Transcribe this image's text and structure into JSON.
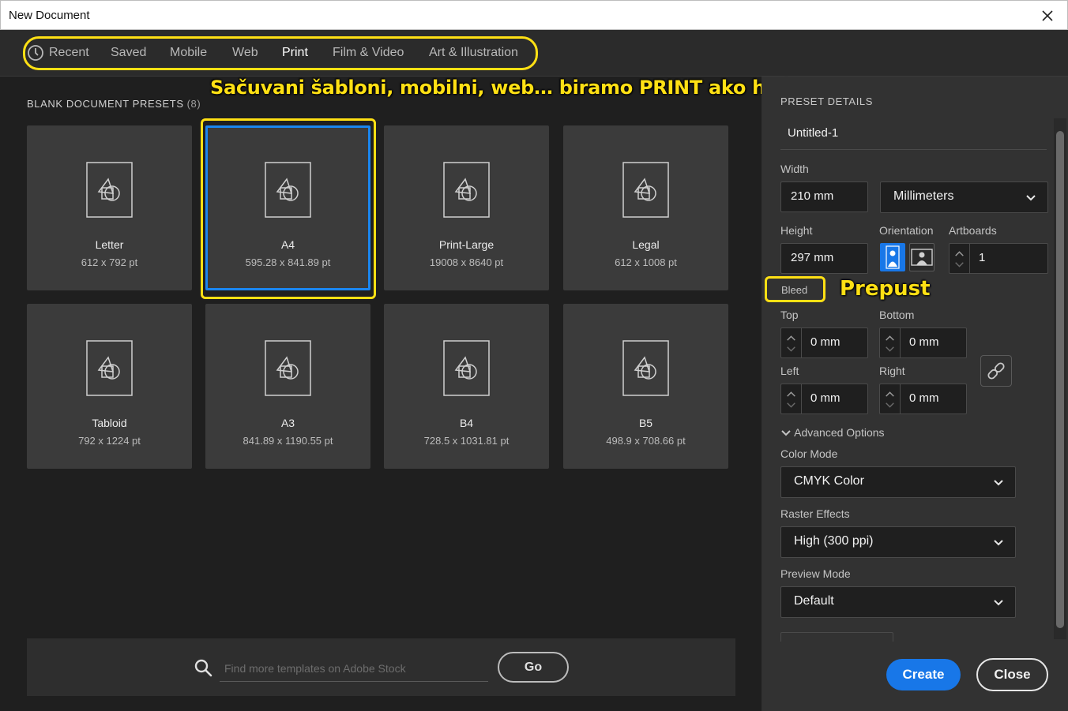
{
  "window": {
    "title": "New Document"
  },
  "tabs": [
    "Recent",
    "Saved",
    "Mobile",
    "Web",
    "Print",
    "Film & Video",
    "Art & Illustration"
  ],
  "active_tab": "Print",
  "annotations": {
    "tabs_note": "Sačuvani šabloni, mobilni, web… biramo PRINT ako hoćemo CMYK boje",
    "bleed_note": "Prepust"
  },
  "presets": {
    "title": "BLANK DOCUMENT PRESETS",
    "count": "(8)",
    "items": [
      {
        "name": "Letter",
        "dims": "612 x 792 pt"
      },
      {
        "name": "A4",
        "dims": "595.28 x 841.89 pt"
      },
      {
        "name": "Print-Large",
        "dims": "19008 x 8640 pt"
      },
      {
        "name": "Legal",
        "dims": "612 x 1008 pt"
      },
      {
        "name": "Tabloid",
        "dims": "792 x 1224 pt"
      },
      {
        "name": "A3",
        "dims": "841.89 x 1190.55 pt"
      },
      {
        "name": "B4",
        "dims": "728.5 x 1031.81 pt"
      },
      {
        "name": "B5",
        "dims": "498.9 x 708.66 pt"
      }
    ],
    "selected": "A4"
  },
  "search": {
    "placeholder": "Find more templates on Adobe Stock",
    "go_label": "Go"
  },
  "details": {
    "title": "PRESET DETAILS",
    "doc_name": "Untitled-1",
    "width_label": "Width",
    "width_value": "210 mm",
    "units": "Millimeters",
    "height_label": "Height",
    "height_value": "297 mm",
    "orientation_label": "Orientation",
    "artboards_label": "Artboards",
    "artboards_value": "1",
    "bleed_label": "Bleed",
    "top_label": "Top",
    "top_value": "0 mm",
    "bottom_label": "Bottom",
    "bottom_value": "0 mm",
    "left_label": "Left",
    "left_value": "0 mm",
    "right_label": "Right",
    "right_value": "0 mm",
    "advanced_label": "Advanced Options",
    "color_mode_label": "Color Mode",
    "color_mode_value": "CMYK Color",
    "raster_label": "Raster Effects",
    "raster_value": "High (300 ppi)",
    "preview_label": "Preview Mode",
    "preview_value": "Default"
  },
  "buttons": {
    "create": "Create",
    "close": "Close"
  },
  "colors": {
    "accent": "#1877e8",
    "highlight": "#ffe014"
  }
}
